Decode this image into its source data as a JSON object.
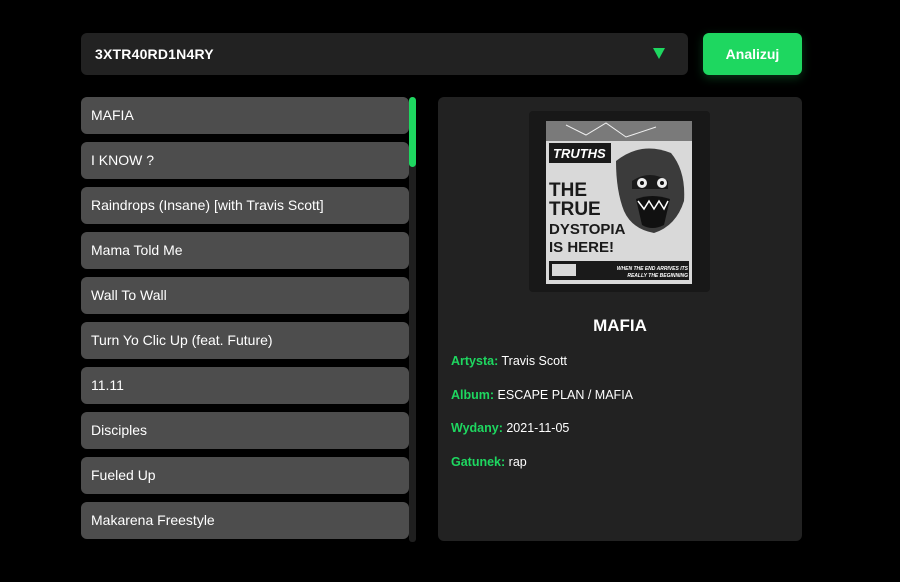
{
  "playlist_select": {
    "value": "3XTR40RD1N4RY"
  },
  "analyze_button": {
    "label": "Analizuj"
  },
  "tracks": [
    "MAFIA",
    "I KNOW ?",
    "Raindrops (Insane) [with Travis Scott]",
    "Mama Told Me",
    "Wall To Wall",
    "Turn Yo Clic Up (feat. Future)",
    "11.11",
    "Disciples",
    "Fueled Up",
    "Makarena Freestyle"
  ],
  "details": {
    "title": "MAFIA",
    "cover": {
      "masthead": "TRUTHS",
      "headline": [
        "THE",
        "TRUE",
        "DYSTOPIA",
        "IS HERE!"
      ],
      "footer": [
        "WHEN THE END ARRIVES ITS",
        "REALLY THE BEGINNING"
      ]
    },
    "fields": [
      {
        "label": "Artysta:",
        "value": "Travis Scott"
      },
      {
        "label": "Album:",
        "value": "ESCAPE PLAN / MAFIA"
      },
      {
        "label": "Wydany:",
        "value": "2021-11-05"
      },
      {
        "label": "Gatunek:",
        "value": "rap"
      }
    ]
  },
  "colors": {
    "accent": "#1ed760",
    "background": "#000000",
    "panel": "#222222",
    "track_item": "#4d4d4d"
  }
}
